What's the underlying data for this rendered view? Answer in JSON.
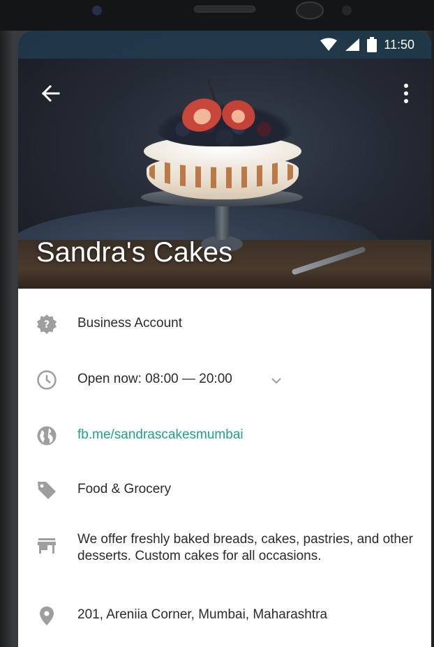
{
  "status_bar": {
    "time": "11:50",
    "icons": [
      "wifi-icon",
      "signal-icon",
      "battery-icon"
    ]
  },
  "toolbar": {
    "back_icon": "arrow-back-icon",
    "more_icon": "more-vert-icon"
  },
  "profile": {
    "name": "Sandra's Cakes"
  },
  "info": {
    "account_type": "Business Account",
    "hours": "Open now: 08:00 — 20:00",
    "website": "fb.me/sandrascakesmumbai",
    "category": "Food & Grocery",
    "description": "We offer freshly baked breads, cakes, pastries, and other desserts. Custom cakes for all occasions.",
    "address": "201, Areniia Corner, Mumbai, Maharashtra"
  },
  "colors": {
    "link": "#1f9f8e",
    "icon_gray": "#9e9e9e",
    "text": "#2b2b2b",
    "status_bar": "#203c4e"
  }
}
